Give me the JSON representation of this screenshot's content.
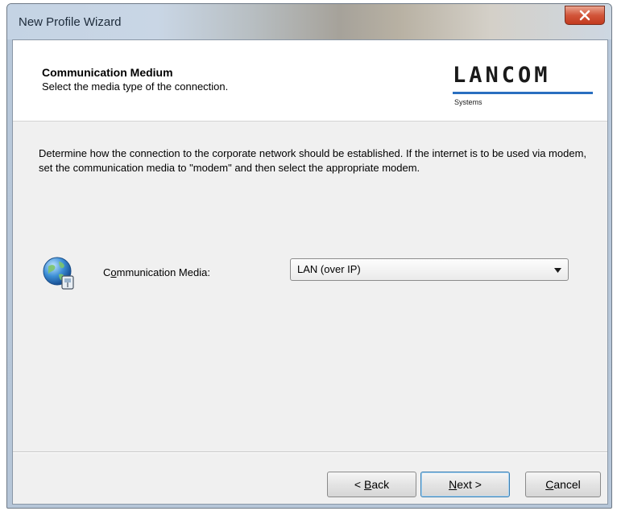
{
  "window": {
    "title": "New Profile Wizard"
  },
  "header": {
    "title": "Communication Medium",
    "subtitle": "Select the media type of the connection.",
    "logo": {
      "name": "LANCOM",
      "sub": "Systems",
      "accent": "#2a6fc0"
    }
  },
  "main": {
    "description": "Determine how the connection to the corporate network should be established. If the internet is to be used via modem, set the communication media to \"modem\" and then select the appropriate modem.",
    "field": {
      "label_prefix": "C",
      "label_accel": "o",
      "label_rest": "mmunication Media:",
      "icon": "globe-network-icon",
      "selected_value": "LAN (over IP)"
    }
  },
  "buttons": {
    "back": {
      "prefix": "< ",
      "accel": "B",
      "rest": "ack"
    },
    "next": {
      "prefix": "",
      "accel": "N",
      "rest": "ext >"
    },
    "cancel": {
      "prefix": "",
      "accel": "C",
      "rest": "ancel"
    }
  }
}
